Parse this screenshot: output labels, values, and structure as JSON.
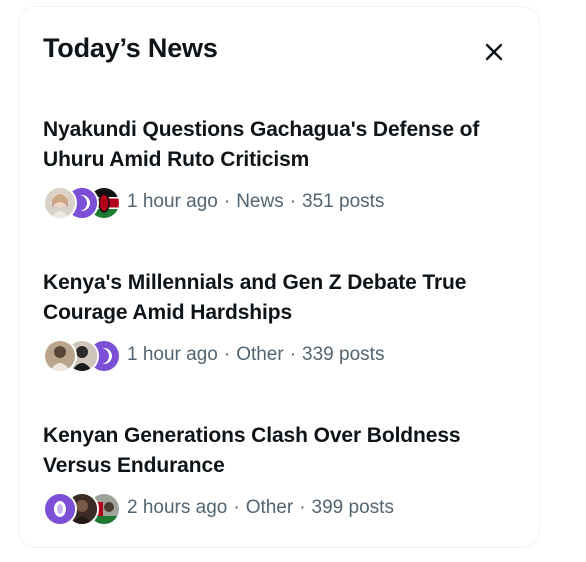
{
  "panel": {
    "title": "Today’s News",
    "close_icon": "close-icon"
  },
  "news": [
    {
      "headline_line1": "Nyakundi Questions Gachagua's Defense of",
      "headline_line2": "Uhuru Amid Ruto Criticism",
      "time": "1 hour ago",
      "category": "News",
      "posts": "351 posts",
      "avatars": [
        "avatar-photo-girl",
        "avatar-purple-logo",
        "avatar-kenya-flag"
      ]
    },
    {
      "headline_line1": "Kenya's Millennials and Gen Z Debate True",
      "headline_line2": "Courage Amid Hardships",
      "time": "1 hour ago",
      "category": "Other",
      "posts": "339 posts",
      "avatars": [
        "avatar-photo-man",
        "avatar-photo-dark",
        "avatar-purple-logo"
      ]
    },
    {
      "headline_line1": "Kenyan Generations Clash Over Boldness",
      "headline_line2": "Versus Endurance",
      "time": "2 hours ago",
      "category": "Other",
      "posts": "399 posts",
      "avatars": [
        "avatar-purple-logo",
        "avatar-photo-dark",
        "avatar-kenya-flag"
      ]
    }
  ],
  "colors": {
    "text_primary": "#0f1419",
    "text_secondary": "#536471",
    "accent_purple": "#7b4fd6",
    "border": "#eff3f4"
  }
}
